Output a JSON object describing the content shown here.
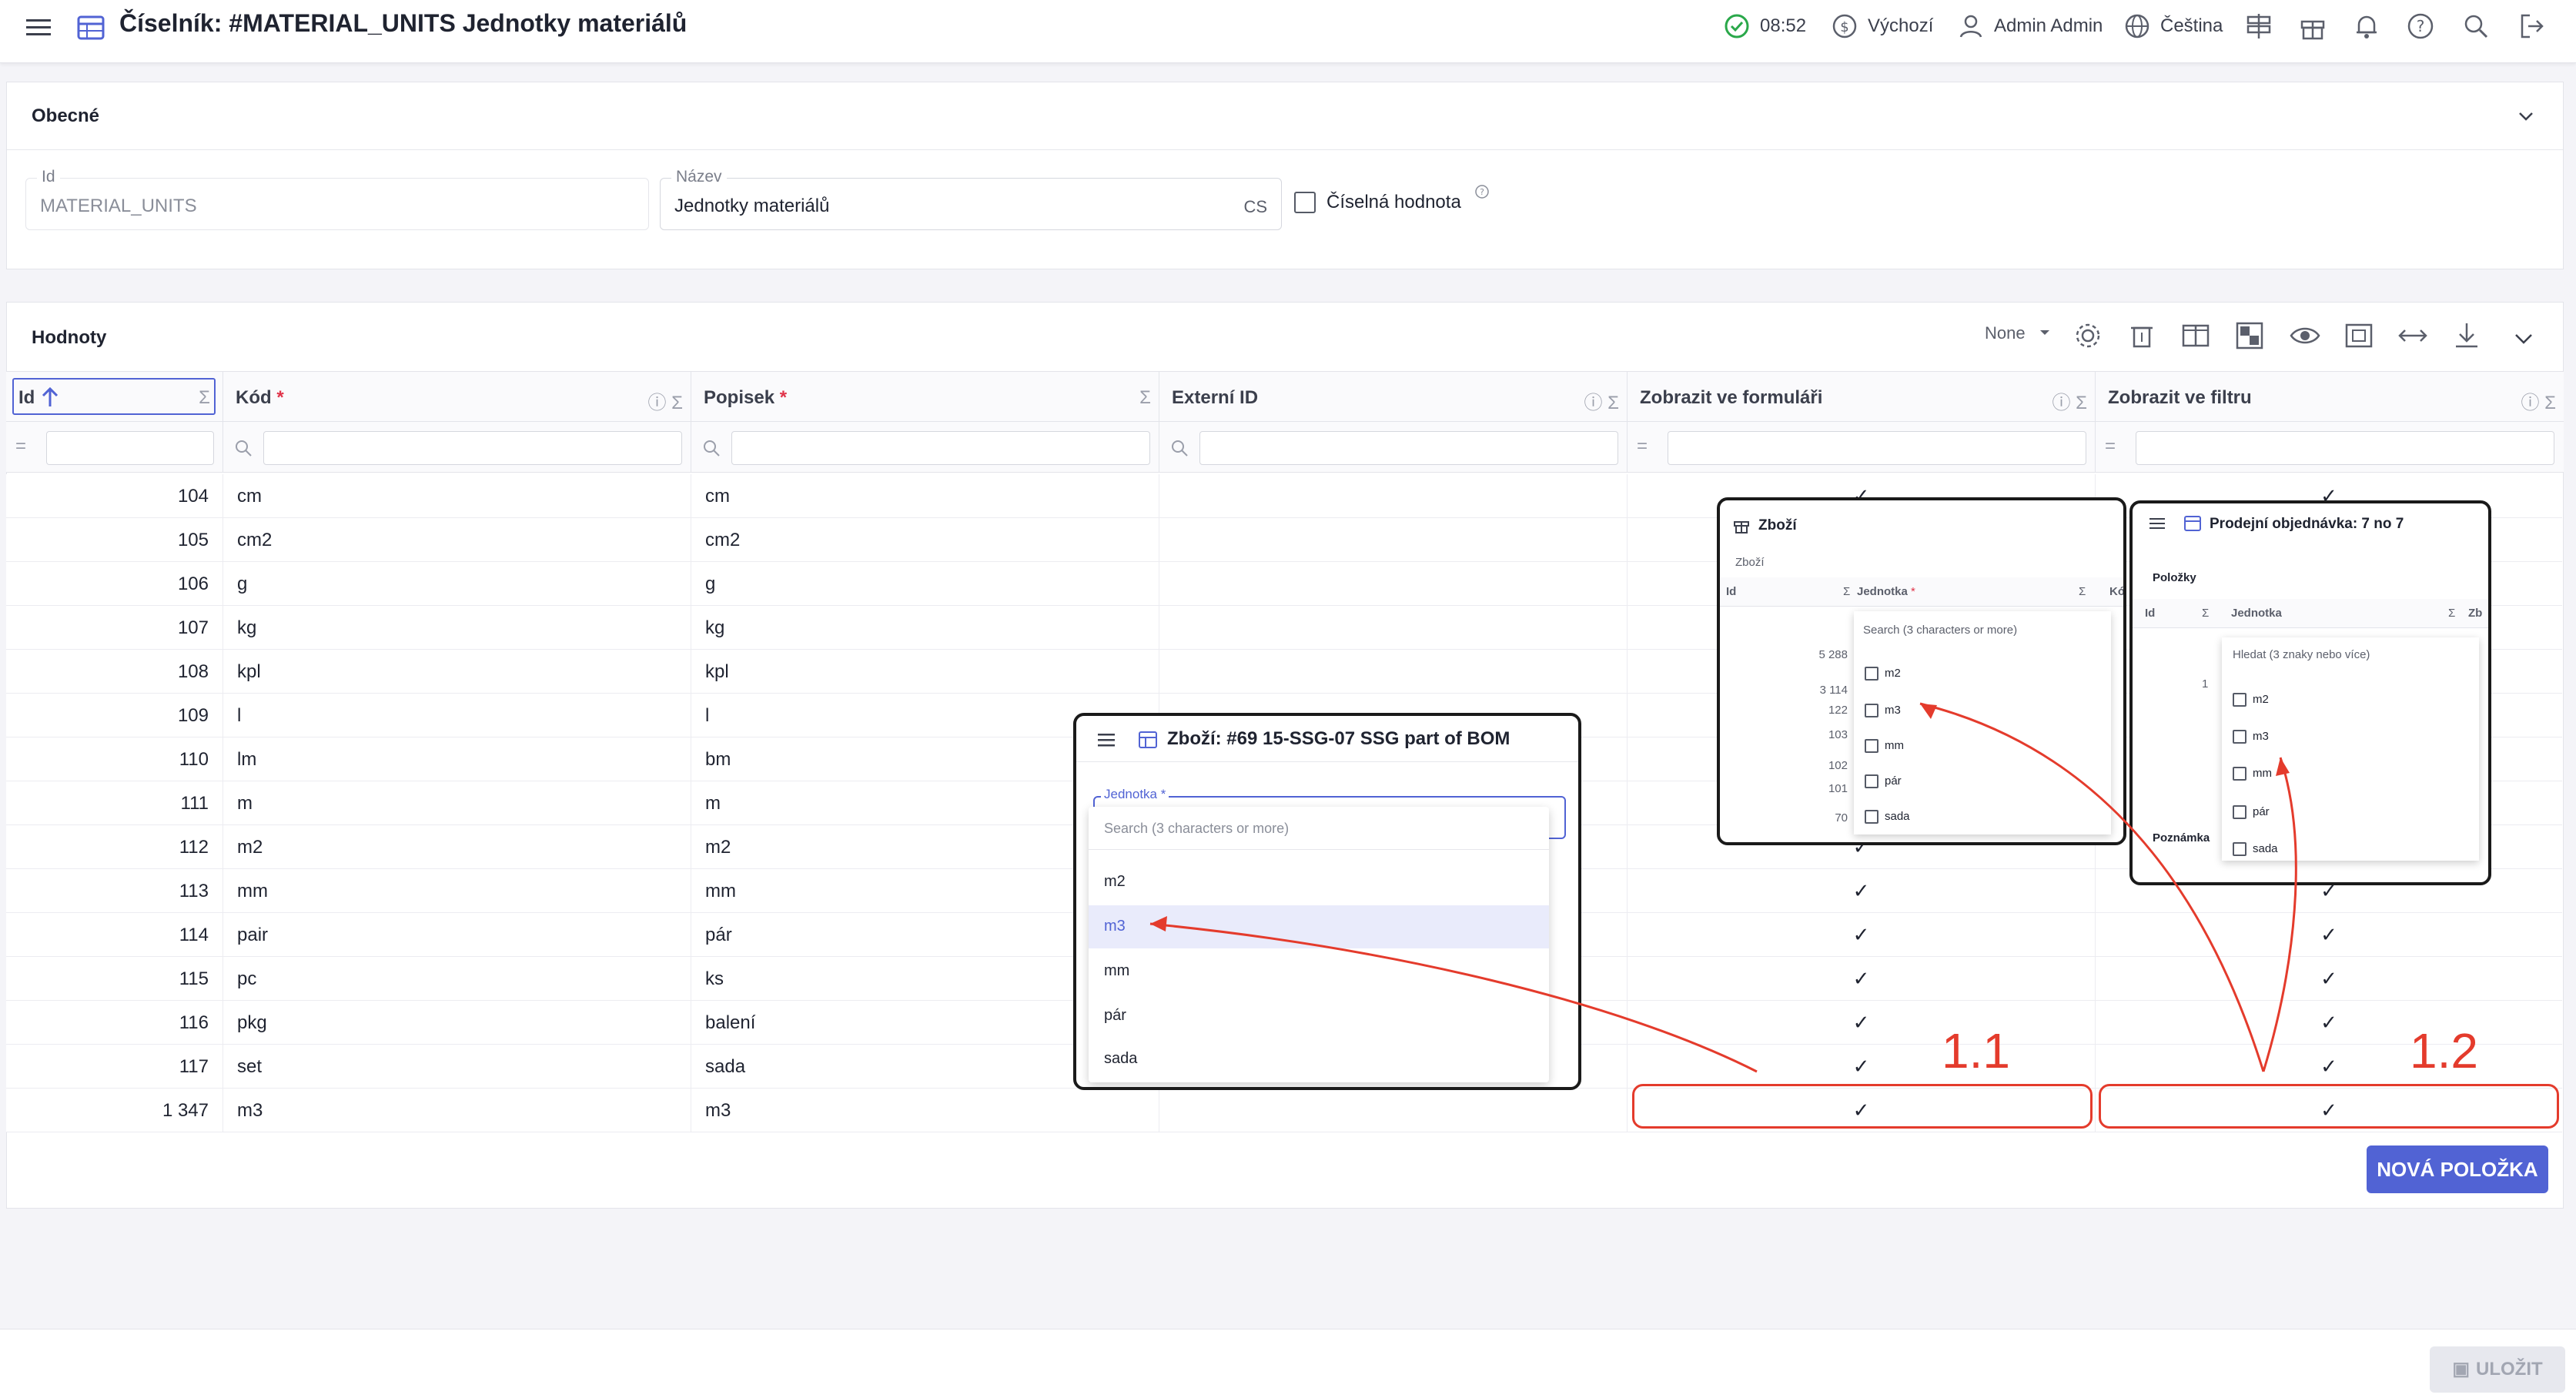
{
  "header": {
    "title": "Číselník: #MATERIAL_UNITS Jednotky materiálů",
    "time": "08:52",
    "currency": "Výchozí",
    "user": "Admin Admin",
    "language": "Čeština"
  },
  "general": {
    "title": "Obecné",
    "id_label": "Id",
    "id_value": "MATERIAL_UNITS",
    "name_label": "Název",
    "name_value": "Jednotky materiálů",
    "name_lang": "CS",
    "numeric_label": "Číselná hodnota"
  },
  "values": {
    "title": "Hodnoty",
    "page_size": "None",
    "columns": {
      "id": "Id",
      "code": "Kód",
      "desc": "Popisek",
      "ext": "Externí ID",
      "form": "Zobrazit ve formuláři",
      "filter": "Zobrazit ve filtru"
    },
    "required_mark": "*",
    "checkmark": "✓",
    "rows": [
      {
        "id": "104",
        "code": "cm",
        "desc": "cm"
      },
      {
        "id": "105",
        "code": "cm2",
        "desc": "cm2"
      },
      {
        "id": "106",
        "code": "g",
        "desc": "g"
      },
      {
        "id": "107",
        "code": "kg",
        "desc": "kg"
      },
      {
        "id": "108",
        "code": "kpl",
        "desc": "kpl"
      },
      {
        "id": "109",
        "code": "l",
        "desc": "l"
      },
      {
        "id": "110",
        "code": "lm",
        "desc": "bm"
      },
      {
        "id": "111",
        "code": "m",
        "desc": "m"
      },
      {
        "id": "112",
        "code": "m2",
        "desc": "m2"
      },
      {
        "id": "113",
        "code": "mm",
        "desc": "mm"
      },
      {
        "id": "114",
        "code": "pair",
        "desc": "pár"
      },
      {
        "id": "115",
        "code": "pc",
        "desc": "ks"
      },
      {
        "id": "116",
        "code": "pkg",
        "desc": "balení"
      },
      {
        "id": "117",
        "code": "set",
        "desc": "sada"
      },
      {
        "id": "1 347",
        "code": "m3",
        "desc": "m3"
      }
    ],
    "new_button": "NOVÁ POLOŽKA"
  },
  "save_button": "ULOŽIT",
  "inset_form": {
    "title": "Zboží: #69 15-SSG-07 SSG part of BOM",
    "field_label": "Jednotka *",
    "search_placeholder": "Search (3 characters or more)",
    "options": [
      "m2",
      "m3",
      "mm",
      "pár",
      "sada"
    ],
    "selected": "m3"
  },
  "inset_goods": {
    "title": "Zboží",
    "subtitle": "Zboží",
    "col_id": "Id",
    "col_unit": "Jednotka",
    "col_extra": "Kó",
    "search_placeholder": "Search (3 characters or more)",
    "ids": [
      "5 288",
      "3 114",
      "122",
      "103",
      "102",
      "101",
      "70"
    ],
    "options": [
      "m2",
      "m3",
      "mm",
      "pár",
      "sada"
    ]
  },
  "inset_order": {
    "title": "Prodejní objednávka: 7 no 7",
    "section": "Položky",
    "col_id": "Id",
    "col_unit": "Jednotka",
    "col_extra": "Zb",
    "search_placeholder": "Hledat (3 znaky nebo více)",
    "row_id": "1",
    "note": "Poznámka",
    "options": [
      "m2",
      "m3",
      "mm",
      "pár",
      "sada"
    ]
  },
  "callouts": {
    "label_1": "1.1",
    "label_2": "1.2"
  },
  "colors": {
    "accent": "#5163d4",
    "annotation": "#e43b2c",
    "success": "#2aa84a"
  }
}
